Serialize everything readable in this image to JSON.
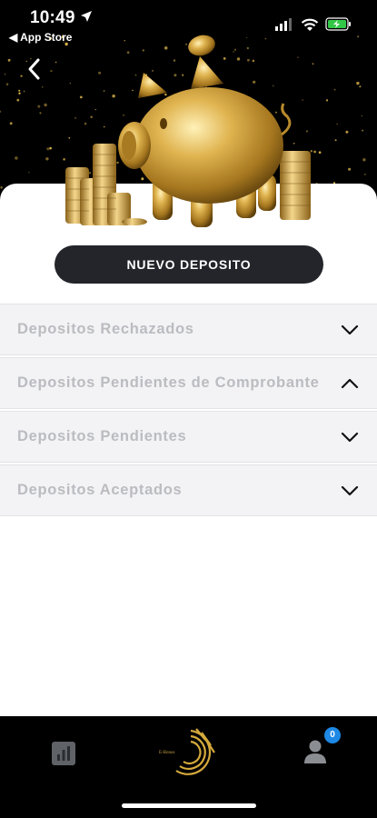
{
  "status_bar": {
    "time": "10:49",
    "back_to_app": "◀ App Store"
  },
  "header": {
    "back_icon": "chevron-left-icon",
    "illustration": "gold-piggy-bank-with-coins"
  },
  "actions": {
    "new_deposit_label": "NUEVO DEPOSITO"
  },
  "sections": [
    {
      "label": "Depositos Rechazados",
      "state": "collapsed",
      "icon": "chevron-down-icon"
    },
    {
      "label": "Depositos Pendientes de Comprobante",
      "state": "expanded",
      "icon": "chevron-up-icon"
    },
    {
      "label": "Depositos Pendientes",
      "state": "collapsed",
      "icon": "chevron-down-icon"
    },
    {
      "label": "Depositos Aceptados",
      "state": "collapsed",
      "icon": "chevron-down-icon"
    }
  ],
  "tab_bar": {
    "stats_icon": "bar-chart-icon",
    "logo_text": "E-Bonos",
    "user_icon": "user-icon",
    "notification_count": "0"
  },
  "colors": {
    "accent_gold": "#c9a23e",
    "button_dark": "#23252a",
    "section_bg": "#f3f3f5",
    "section_text": "#bbbcc1",
    "badge_blue": "#1e88e5"
  }
}
